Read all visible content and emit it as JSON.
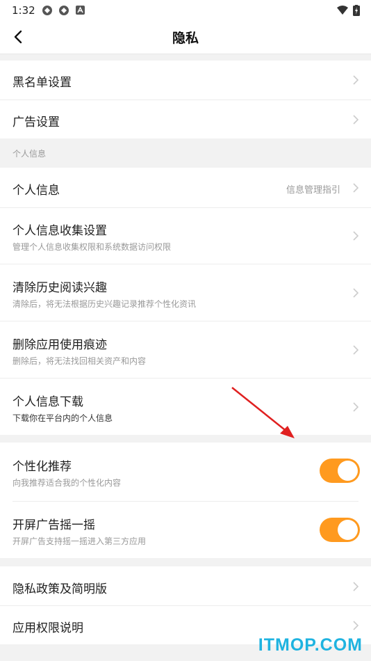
{
  "status_bar": {
    "time": "1:32"
  },
  "nav": {
    "title": "隐私"
  },
  "group1": {
    "items": [
      {
        "label": "黑名单设置"
      },
      {
        "label": "广告设置"
      }
    ]
  },
  "section_personal": {
    "header": "个人信息"
  },
  "group2": {
    "items": [
      {
        "label": "个人信息",
        "value": "信息管理指引"
      },
      {
        "label": "个人信息收集设置",
        "subtitle": "管理个人信息收集权限和系统数据访问权限"
      },
      {
        "label": "清除历史阅读兴趣",
        "subtitle": "清除后，将无法根据历史兴趣记录推荐个性化资讯"
      },
      {
        "label": "删除应用使用痕迹",
        "subtitle": "删除后，将无法找回相关资产和内容"
      },
      {
        "label": "个人信息下载",
        "subtitle": "下载你在平台内的个人信息"
      }
    ]
  },
  "group3": {
    "items": [
      {
        "label": "个性化推荐",
        "subtitle": "向我推荐适合我的个性化内容",
        "on": true
      },
      {
        "label": "开屏广告摇一摇",
        "subtitle": "开屏广告支持摇一摇进入第三方应用",
        "on": true
      }
    ]
  },
  "group4": {
    "items": [
      {
        "label": "隐私政策及简明版"
      },
      {
        "label": "应用权限说明"
      }
    ]
  },
  "colors": {
    "accent": "#ff9a1f",
    "annotation_arrow": "#e02020",
    "watermark": "#1fb3e0"
  },
  "watermark": "ITMOP.COM"
}
